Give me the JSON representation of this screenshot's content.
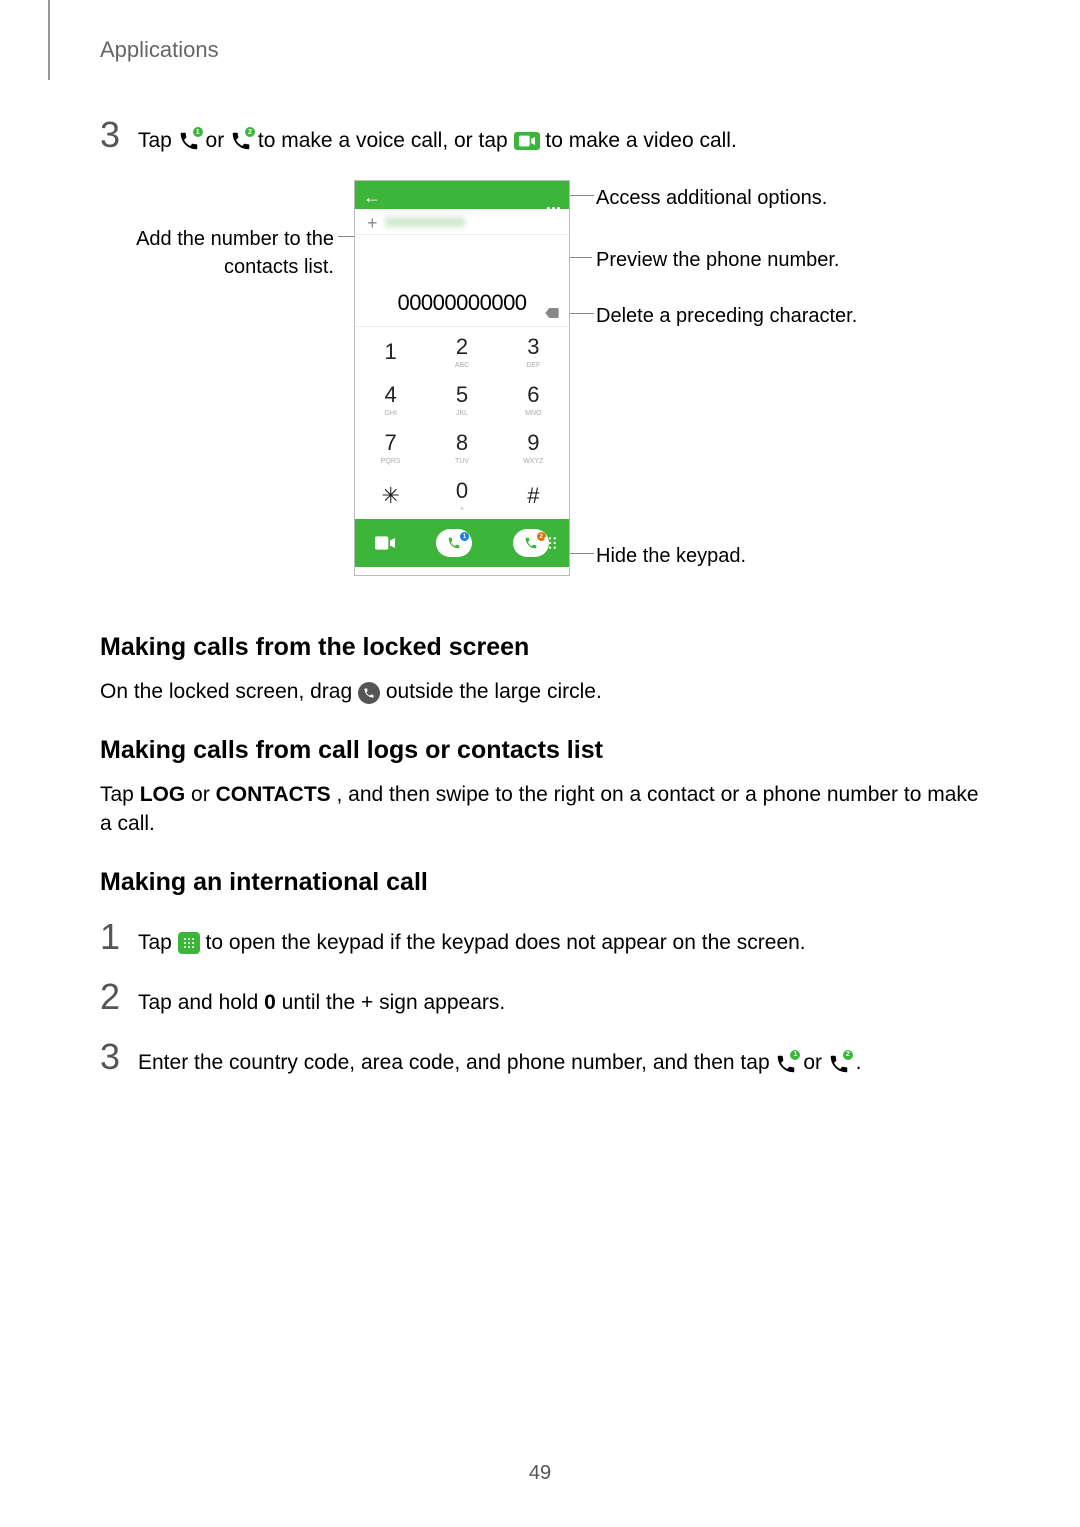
{
  "header": {
    "section": "Applications"
  },
  "step3_top": {
    "num": "3",
    "pre": "Tap ",
    "or": " or ",
    "mid": " to make a voice call, or tap ",
    "post": " to make a video call."
  },
  "diagram": {
    "callout_add": "Add the number to the contacts list.",
    "callout_options": "Access additional options.",
    "callout_preview": "Preview the phone number.",
    "callout_delete": "Delete a preceding character.",
    "callout_hide": "Hide the keypad.",
    "number_display": "00000000000",
    "keys": [
      {
        "d": "1",
        "s": ""
      },
      {
        "d": "2",
        "s": "ABC"
      },
      {
        "d": "3",
        "s": "DEF"
      },
      {
        "d": "4",
        "s": "GHI"
      },
      {
        "d": "5",
        "s": "JKL"
      },
      {
        "d": "6",
        "s": "MNO"
      },
      {
        "d": "7",
        "s": "PQRS"
      },
      {
        "d": "8",
        "s": "TUV"
      },
      {
        "d": "9",
        "s": "WXYZ"
      },
      {
        "d": "✳",
        "s": ""
      },
      {
        "d": "0",
        "s": "+"
      },
      {
        "d": "#",
        "s": ""
      }
    ]
  },
  "sections": {
    "locked_title": "Making calls from the locked screen",
    "locked_text_pre": "On the locked screen, drag ",
    "locked_text_post": " outside the large circle.",
    "logs_title": "Making calls from call logs or contacts list",
    "logs_text_pre": "Tap ",
    "logs_tab1": "LOG",
    "logs_or": " or ",
    "logs_tab2": "CONTACTS",
    "logs_text_post": ", and then swipe to the right on a contact or a phone number to make a call.",
    "intl_title": "Making an international call",
    "intl_s1_num": "1",
    "intl_s1_pre": "Tap ",
    "intl_s1_post": " to open the keypad if the keypad does not appear on the screen.",
    "intl_s2_num": "2",
    "intl_s2_pre": "Tap and hold ",
    "intl_s2_key": "0",
    "intl_s2_post": " until the + sign appears.",
    "intl_s3_num": "3",
    "intl_s3_pre": "Enter the country code, area code, and phone number, and then tap ",
    "intl_s3_or": " or ",
    "intl_s3_post": "."
  },
  "page_number": "49"
}
